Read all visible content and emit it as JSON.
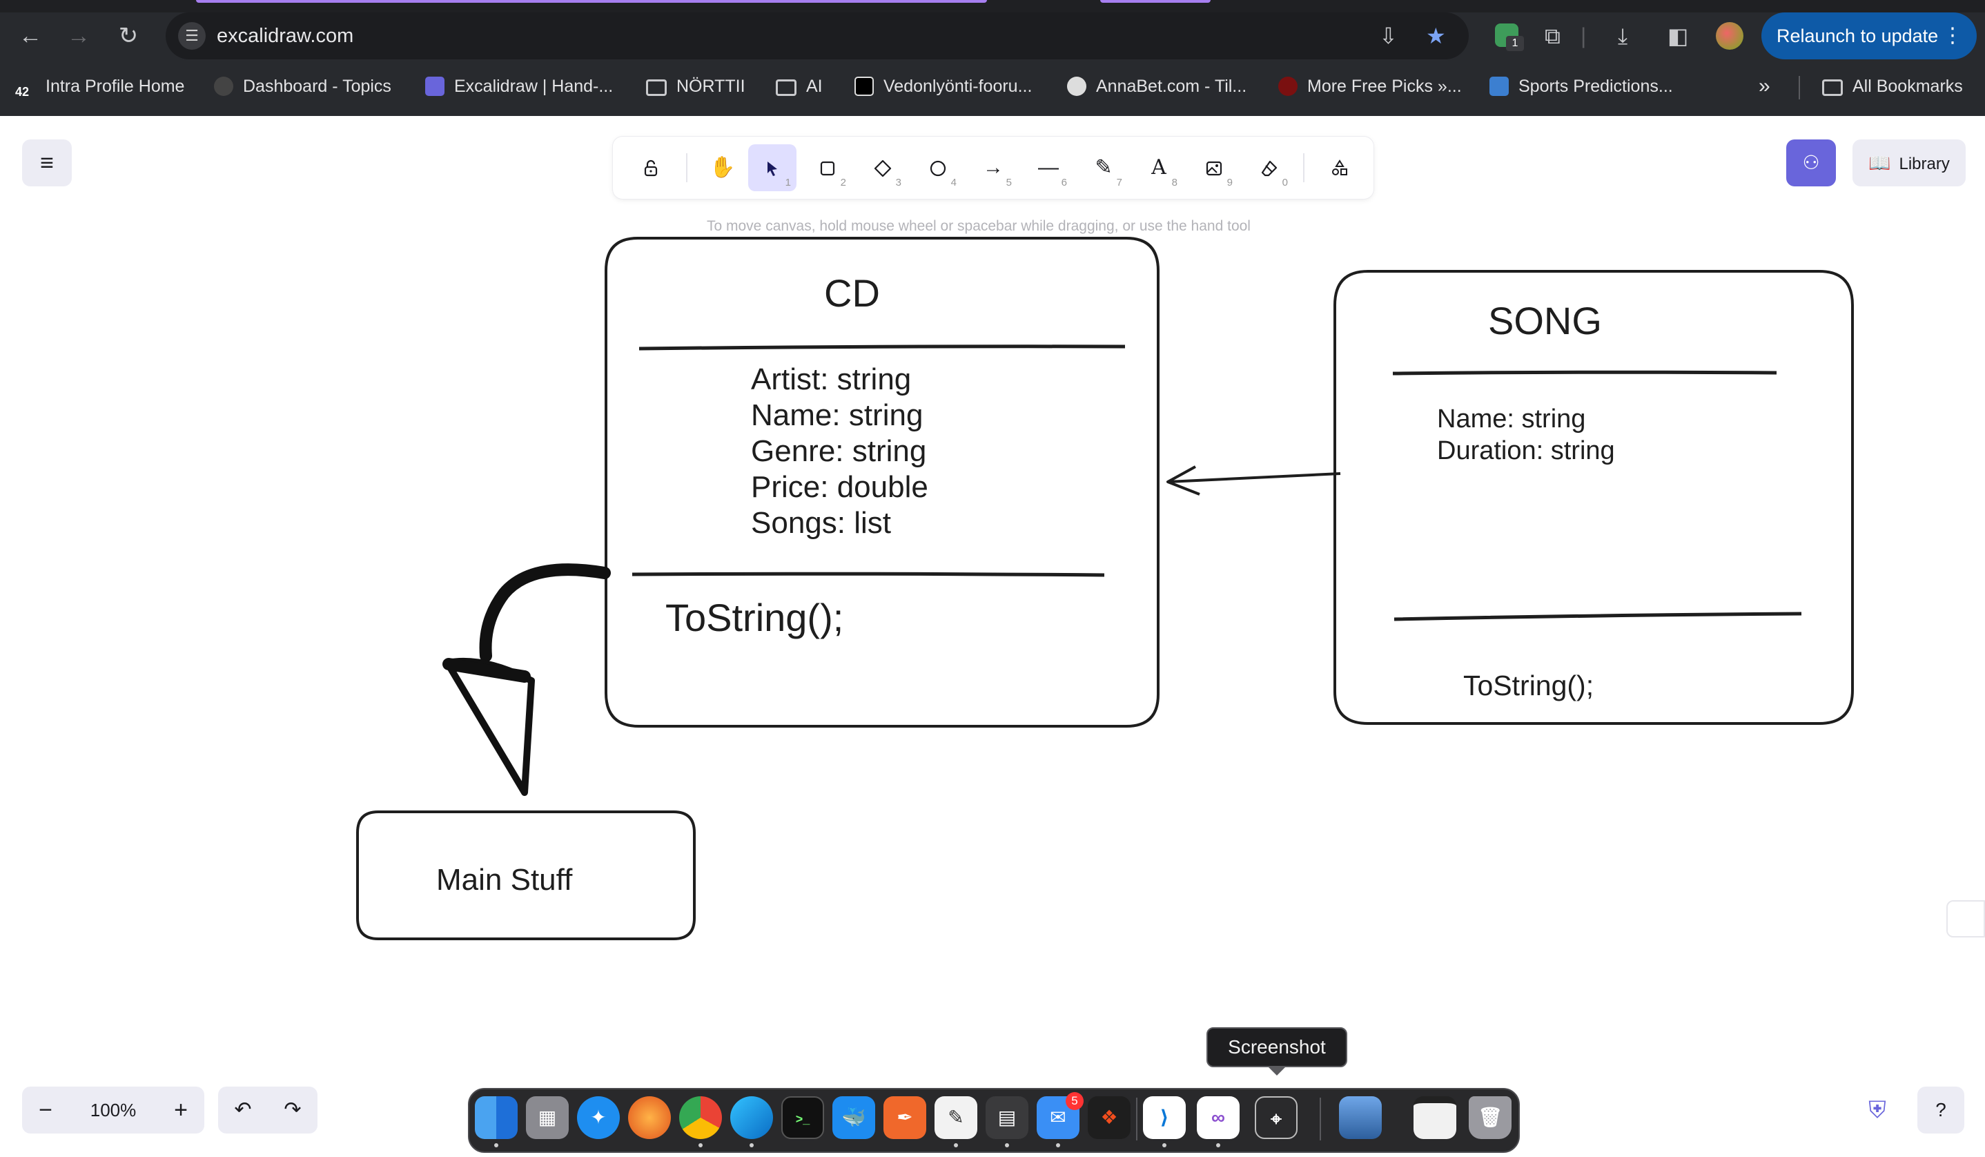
{
  "browser": {
    "url": "excalidraw.com",
    "relaunch_label": "Relaunch to update",
    "extension_badge": "1",
    "bookmarks": [
      {
        "label": "Intra Profile Home",
        "icon": "42-logo-icon"
      },
      {
        "label": "Dashboard - Topics",
        "icon": "dashboard-logo-icon"
      },
      {
        "label": "Excalidraw | Hand-...",
        "icon": "excalidraw-logo-icon"
      },
      {
        "label": "NÖRTTII",
        "icon": "folder-icon"
      },
      {
        "label": "AI",
        "icon": "folder-icon"
      },
      {
        "label": "Vedonlyönti-fooru...",
        "icon": "terminal-logo-icon"
      },
      {
        "label": "AnnaBet.com - Til...",
        "icon": "soccer-ball-icon"
      },
      {
        "label": "More Free Picks »...",
        "icon": "red-logo-icon"
      },
      {
        "label": "Sports Predictions...",
        "icon": "sports-logo-icon"
      }
    ],
    "overflow_label": "»",
    "all_bookmarks_label": "All Bookmarks"
  },
  "excalidraw": {
    "tools": [
      {
        "name": "lock",
        "icon": "lock-icon",
        "key": ""
      },
      {
        "name": "hand",
        "icon": "hand-icon",
        "key": ""
      },
      {
        "name": "selection",
        "icon": "pointer-icon",
        "key": "1"
      },
      {
        "name": "rectangle",
        "icon": "rectangle-icon",
        "key": "2"
      },
      {
        "name": "diamond",
        "icon": "diamond-icon",
        "key": "3"
      },
      {
        "name": "ellipse",
        "icon": "ellipse-icon",
        "key": "4"
      },
      {
        "name": "arrow",
        "icon": "arrow-icon",
        "key": "5"
      },
      {
        "name": "line",
        "icon": "line-icon",
        "key": "6"
      },
      {
        "name": "draw",
        "icon": "pencil-icon",
        "key": "7"
      },
      {
        "name": "text",
        "icon": "text-icon",
        "key": "8"
      },
      {
        "name": "image",
        "icon": "image-icon",
        "key": "9"
      },
      {
        "name": "eraser",
        "icon": "eraser-icon",
        "key": "0"
      },
      {
        "name": "extra-tools",
        "icon": "shapes-icon",
        "key": ""
      }
    ],
    "active_tool": "selection",
    "hint": "To move canvas, hold mouse wheel or spacebar while dragging, or use the hand tool",
    "library_label": "Library",
    "zoom": "100%",
    "accent_color": "#6965db"
  },
  "diagram": {
    "cd": {
      "title": "CD",
      "fields": [
        "Artist: string",
        "Name: string",
        "Genre: string",
        "Price: double",
        "Songs: list"
      ],
      "method": "ToString();"
    },
    "song": {
      "title": "SONG",
      "fields": [
        "Name: string",
        "Duration: string"
      ],
      "method": "ToString();"
    },
    "main": {
      "label": "Main Stuff"
    }
  },
  "dock": {
    "tooltip": "Screenshot",
    "mail_badge": "5",
    "apps": [
      "finder",
      "launchpad",
      "safari",
      "firefox",
      "chrome",
      "edge",
      "terminal",
      "docker",
      "swift-playgrounds",
      "textedit",
      "calculator",
      "mail",
      "figma",
      "vscode",
      "visual-studio",
      "screenshot",
      "preview",
      "chrome-window",
      "trash"
    ]
  }
}
